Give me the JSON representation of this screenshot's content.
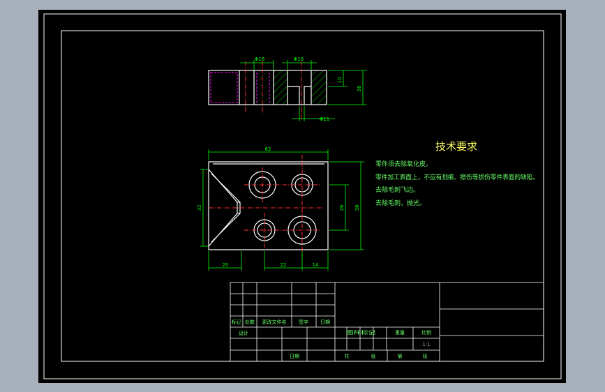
{
  "colors": {
    "background": "#a8b0bc",
    "sheet": "#000000",
    "frame": "#ffffff",
    "dimension": "#00ff00",
    "centerline": "#ff0000",
    "hidden": "#ff00ff",
    "title": "#ffff66",
    "notes": "#66ff66",
    "table_line": "#ffffff"
  },
  "top_view": {
    "dim_left": "Φ16",
    "dim_right": "Φ16",
    "dim_height_small": "10",
    "dim_height_total": "26",
    "dim_bottom": "Φ11"
  },
  "front_view": {
    "dim_width": "62",
    "dim_left_height": "32",
    "dim_right_inner": "26",
    "dim_right_total": "38",
    "dim_bottom_left": "20",
    "dim_bottom_mid": "22",
    "dim_bottom_right": "14"
  },
  "technical_requirements": {
    "title": "技术要求",
    "items": [
      "零件须去除氧化皮。",
      "零件加工表面上，不应有划痕、擦伤等损伤零件表面的缺陷。",
      "去除毛刺飞边。",
      "去除毛刺，抛光。"
    ]
  },
  "title_block": {
    "row_labels": [
      "标记",
      "处数",
      "更改文件名",
      "签字",
      "日期"
    ],
    "design": "设计",
    "date": "日期",
    "stage_mark": "图样标记",
    "weight": "重量",
    "scale": "比例",
    "scale_value": "1:1",
    "total": "共",
    "sheets": "张",
    "sheet_no": "第",
    "sheet_unit": "张"
  }
}
